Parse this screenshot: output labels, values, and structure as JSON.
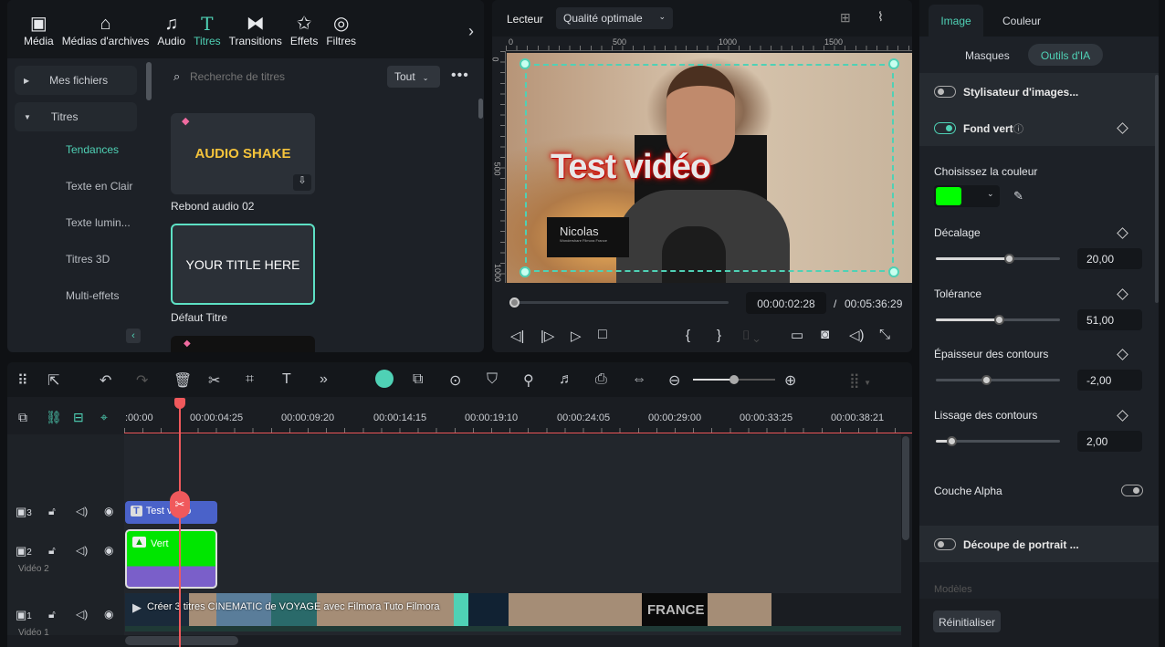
{
  "nav": [
    {
      "label": "Média",
      "icon": "media-icon"
    },
    {
      "label": "Médias d'archives",
      "icon": "stock-media-icon"
    },
    {
      "label": "Audio",
      "icon": "music-note-icon"
    },
    {
      "label": "Titres",
      "icon": "title-t-icon",
      "active": true
    },
    {
      "label": "Transitions",
      "icon": "transitions-icon"
    },
    {
      "label": "Effets",
      "icon": "effects-icon"
    },
    {
      "label": "Filtres",
      "icon": "filters-icon"
    }
  ],
  "library": {
    "folders": [
      {
        "label": "Mes fichiers"
      },
      {
        "label": "Titres"
      }
    ],
    "subitems": [
      "Tendances",
      "Texte en Clair",
      "Texte lumin...",
      "Titres 3D",
      "Multi-effets"
    ],
    "search_placeholder": "Recherche de titres",
    "filter": "Tout",
    "cards": [
      {
        "thumb": "AUDIO SHAKE",
        "caption": "Rebond audio 02"
      },
      {
        "thumb": "YOUR TITLE HERE",
        "caption": "Défaut Titre"
      }
    ]
  },
  "player": {
    "label": "Lecteur",
    "quality": "Qualité optimale",
    "ruler_h": [
      "0",
      "500",
      "1000",
      "1500"
    ],
    "ruler_v": [
      "0",
      "500",
      "1000"
    ],
    "title_text": "Test vidéo",
    "lower_third_name": "Nicolas",
    "lower_third_sub": "Wondershare Filmora France",
    "current_time": "00:00:02:28",
    "separator": "/",
    "total_time": "00:05:36:29",
    "progress": 0.009
  },
  "right": {
    "tabs": [
      "Image",
      "Couleur"
    ],
    "subtabs": [
      "Masques",
      "Outils d'IA"
    ],
    "stylizer": "Stylisateur d'images...",
    "green_screen": "Fond vert",
    "choose_color": "Choisissez la couleur",
    "key_color": "#00ff00",
    "params": [
      {
        "label": "Décalage",
        "value": "20,00",
        "fraction": 0.6
      },
      {
        "label": "Tolérance",
        "value": "51,00",
        "fraction": 0.51
      },
      {
        "label": "Épaisseur des contours",
        "value": "-2,00",
        "fraction": 0.4
      },
      {
        "label": "Lissage des contours",
        "value": "2,00",
        "fraction": 0.13
      }
    ],
    "alpha": "Couche Alpha",
    "portrait": "Découpe de portrait ...",
    "models": "Modèles",
    "reset": "Réinitialiser"
  },
  "timeline": {
    "ticks": [
      ":00:00",
      "00:00:04:25",
      "00:00:09:20",
      "00:00:14:15",
      "00:00:19:10",
      "00:00:24:05",
      "00:00:29:00",
      "00:00:33:25",
      "00:00:38:21"
    ],
    "tracks": [
      {
        "num": "3",
        "name": ""
      },
      {
        "num": "2",
        "name": "Vidéo 2"
      },
      {
        "num": "1",
        "name": "Vidéo 1"
      }
    ],
    "clips": {
      "title": "Test vidéo",
      "green": "Vert",
      "main": "Créer 3 titres CINEMATIC de VOYAGE avec Filmora  Tuto Filmora",
      "france": "FRANCE"
    }
  },
  "colors": {
    "accent": "#4fd1b5",
    "playhead": "#f0595c",
    "title_clip": "#4a62c9",
    "green_clip": "#00e600",
    "purple": "#7a5fc9"
  }
}
